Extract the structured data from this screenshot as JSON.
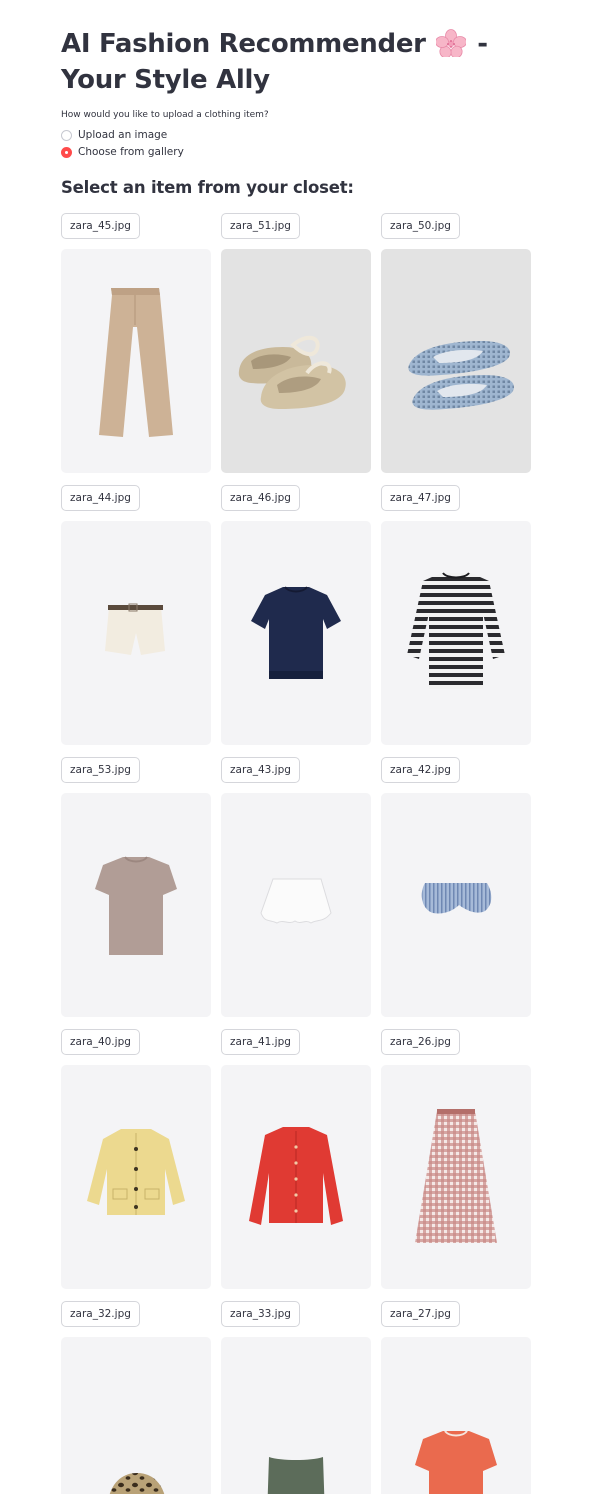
{
  "header": {
    "title_part1": "AI Fashion Recommender",
    "title_part2": "- Your Style Ally",
    "title_emoji": "cherry-blossom-icon"
  },
  "upload": {
    "question": "How would you like to upload a clothing item?",
    "options": [
      {
        "label": "Upload an image",
        "selected": false
      },
      {
        "label": "Choose from gallery",
        "selected": true
      }
    ]
  },
  "gallery": {
    "heading": "Select an item from your closet:",
    "items": [
      {
        "filename": "zara_45.jpg",
        "item": "beige-wide-leg-trousers"
      },
      {
        "filename": "zara_51.jpg",
        "item": "beige-suede-ballet-flats-with-laces"
      },
      {
        "filename": "zara_50.jpg",
        "item": "blue-mesh-ballet-flats"
      },
      {
        "filename": "zara_44.jpg",
        "item": "cream-belted-shorts"
      },
      {
        "filename": "zara_46.jpg",
        "item": "navy-knit-short-sleeve-top"
      },
      {
        "filename": "zara_47.jpg",
        "item": "black-white-striped-sweater"
      },
      {
        "filename": "zara_53.jpg",
        "item": "taupe-tshirt"
      },
      {
        "filename": "zara_43.jpg",
        "item": "white-bubble-skirt"
      },
      {
        "filename": "zara_42.jpg",
        "item": "blue-striped-bloomer-shorts"
      },
      {
        "filename": "zara_40.jpg",
        "item": "yellow-knit-cardigan"
      },
      {
        "filename": "zara_41.jpg",
        "item": "red-cardigan"
      },
      {
        "filename": "zara_26.jpg",
        "item": "red-gingham-midi-skirt"
      },
      {
        "filename": "zara_32.jpg",
        "item": "leopard-bucket-hat"
      },
      {
        "filename": "zara_33.jpg",
        "item": "green-tube-top"
      },
      {
        "filename": "zara_27.jpg",
        "item": "orange-knit-tshirt"
      }
    ]
  },
  "colors": {
    "accent": "#ff4b4b",
    "text": "#31333f",
    "image_bg": "#f4f4f6"
  }
}
